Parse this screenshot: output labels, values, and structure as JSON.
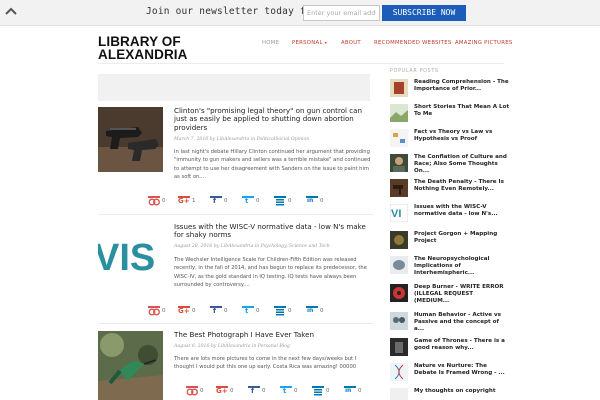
{
  "newsletter": {
    "text": "Join our newsletter today for free.",
    "email_placeholder": "Enter your email address",
    "subscribe_label": "SUBSCRIBE NOW",
    "accent": "#1b5db8"
  },
  "site": {
    "logo_line1": "LIBRARY OF",
    "logo_line2": "ALEXANDRIA"
  },
  "nav": {
    "items": [
      "HOME",
      "PERSONAL",
      "ABOUT",
      "RECOMMENDED WEBSITES",
      "AMAZING PICTURES"
    ],
    "accent": "#c0392b"
  },
  "posts": [
    {
      "title": "Clinton's \"promising legal theory\" on gun control can just as easily be applied to shutting down abortion providers",
      "meta": "March 7, 2016   by LibAlexandria   in PoliticalSocial Opinion",
      "excerpt": "In last night's debate Hillary Clinton continued her argument that providing \"immunity to gun makers and sellers was a terrible mistake\" and continued to attempt to use her disagreement with Sanders on the issue to paint him as soft on....",
      "shares": [
        "0",
        "1",
        "0",
        "0",
        "0",
        "0"
      ],
      "thumb_icon": "handgun-photo"
    },
    {
      "title": "Issues with the WISC-V normative data - low N's make for shaky norms",
      "meta": "August 20, 2016   by LibAlexandria   in Psychology, Science and Tech",
      "excerpt": "The Wechsler Intelligence Scale for Children-Fifth Edition was released recently, in the fall of 2014, and has begun to replace its predecessor, the WISC-IV, as the gold standard in IQ testing. IQ tests have always been surrounded by controversy....",
      "shares": [
        "0",
        "0",
        "0",
        "0",
        "0",
        "0"
      ],
      "thumb_text": "VIS"
    },
    {
      "title": "The Best Photograph I Have Ever Taken",
      "meta": "August 6, 2016   by LibAlexandria   in Personal Blog",
      "excerpt": "There are lots more pictures to come in the next few days/weeks but I thought I would put this one up early. Costa Rica was amazing! 00000",
      "shares": [
        "0",
        "0",
        "0",
        "0",
        "0",
        "0"
      ],
      "thumb_icon": "hummingbird-photo"
    }
  ],
  "share_colors": [
    "#d9534f",
    "#dd4b39",
    "#3b5998",
    "#1da1f2",
    "#0077b5",
    "#0077b5"
  ],
  "sidebar": {
    "title": "POPULAR POSTS",
    "items": [
      "Reading Comprehension - The Importance of Prior...",
      "Short Stories That Mean A Lot To Me",
      "Fact vs Theory vs Law vs Hypothesis vs Proof",
      "The Conflation of Culture and Race; Also Some Thoughts On...",
      "The Death Penalty - There Is Nothing Even Remotely...",
      "Issues with the WISC-V normative data - low N's...",
      "Project Gorgon + Mapping Project",
      "The Neuropsychological Implications of Interhemispheric...",
      "Deep Burner - WRITE ERROR (ILLEGAL REQUEST (MEDIUM...",
      "Human Behavior - Active vs Passive and the concept of a...",
      "Game of Thrones - There is a good reason why...",
      "Nature vs Nurture: The Debate Is Framed Wrong - ...",
      "My thoughts on copyright"
    ]
  }
}
